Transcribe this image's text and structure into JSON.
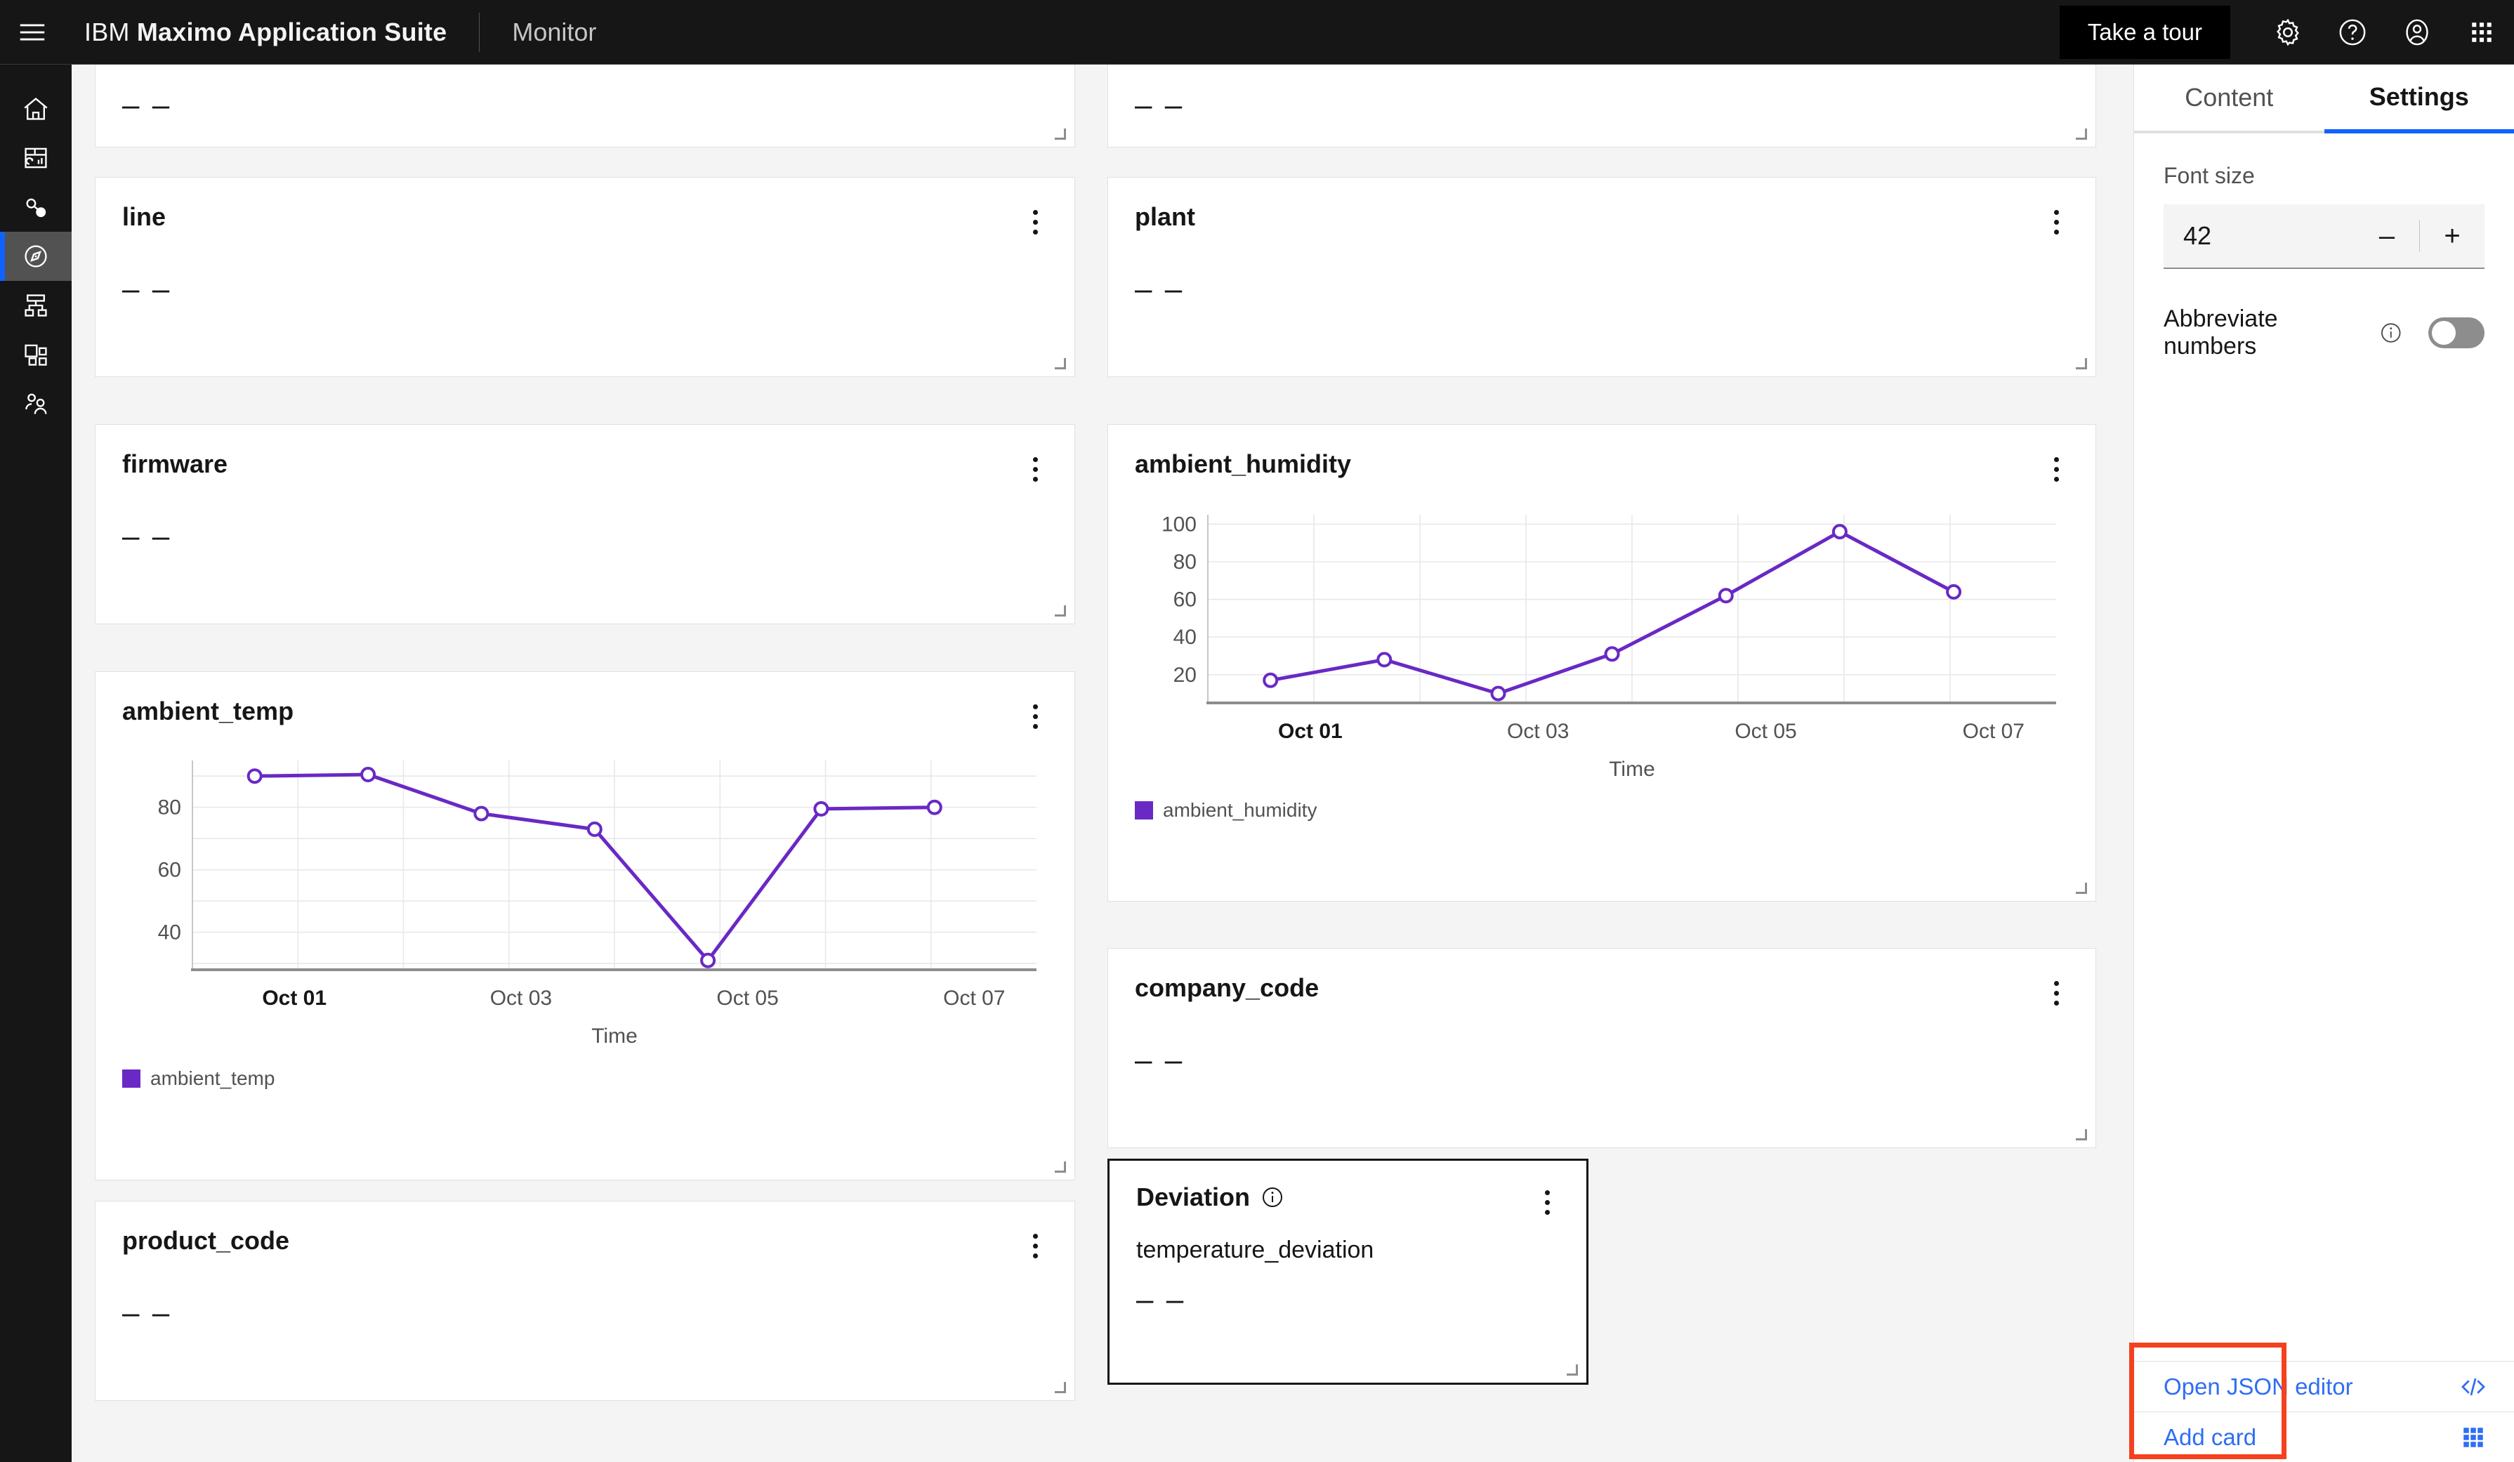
{
  "header": {
    "menu_icon": "hamburger-menu-icon",
    "brand_prefix": "IBM",
    "brand_name": "Maximo Application Suite",
    "product": "Monitor",
    "tour_label": "Take a tour",
    "icons": [
      "gear-icon",
      "help-icon",
      "user-avatar-icon",
      "app-switcher-icon"
    ]
  },
  "sidebar": {
    "items": [
      {
        "name": "home-icon",
        "label": "Home"
      },
      {
        "name": "dashboard-icon",
        "label": "Dashboard"
      },
      {
        "name": "asset-link-icon",
        "label": "Assets"
      },
      {
        "name": "compass-icon",
        "label": "Monitor",
        "active": true
      },
      {
        "name": "hierarchy-icon",
        "label": "Hierarchy"
      },
      {
        "name": "app-group-icon",
        "label": "Applications"
      },
      {
        "name": "users-icon",
        "label": "Users"
      }
    ]
  },
  "dashboard": {
    "placeholder_value": "– –",
    "cards": [
      {
        "id": "card-top-left",
        "title": "",
        "value": "– –"
      },
      {
        "id": "card-top-right",
        "title": "",
        "value": "– –"
      },
      {
        "id": "card-line",
        "title": "line",
        "value": "– –"
      },
      {
        "id": "card-plant",
        "title": "plant",
        "value": "– –"
      },
      {
        "id": "card-firmware",
        "title": "firmware",
        "value": "– –"
      },
      {
        "id": "card-company",
        "title": "company_code",
        "value": "– –"
      },
      {
        "id": "card-product",
        "title": "product_code",
        "value": "– –"
      },
      {
        "id": "card-deviation",
        "title": "Deviation",
        "subtitle": "temperature_deviation",
        "value": "– –",
        "selected": true,
        "has_info_icon": true
      }
    ]
  },
  "chart_data": [
    {
      "id": "ambient_temp",
      "type": "line",
      "title": "ambient_temp",
      "xlabel": "Time",
      "ylabel": "",
      "legend": [
        "ambient_temp"
      ],
      "legend_position": "bottom-left",
      "color": "#6929c4",
      "grid": true,
      "ylim": [
        28,
        95
      ],
      "yticks": [
        40,
        60,
        80
      ],
      "xticks": [
        "Oct 01",
        "Oct 03",
        "Oct 05",
        "Oct 07"
      ],
      "x": [
        "Oct 01",
        "Oct 01.5",
        "Oct 02.7",
        "Oct 03.5",
        "Oct 04.6",
        "Oct 05.5",
        "Oct 06.6"
      ],
      "values": [
        90,
        90.5,
        78,
        73,
        31,
        79.5,
        80
      ]
    },
    {
      "id": "ambient_humidity",
      "type": "line",
      "title": "ambient_humidity",
      "xlabel": "Time",
      "ylabel": "",
      "legend": [
        "ambient_humidity"
      ],
      "legend_position": "bottom-left",
      "color": "#6929c4",
      "grid": true,
      "ylim": [
        5,
        105
      ],
      "yticks": [
        20,
        40,
        60,
        80,
        100
      ],
      "xticks": [
        "Oct 01",
        "Oct 03",
        "Oct 05",
        "Oct 07"
      ],
      "x": [
        "Oct 01",
        "Oct 01.5",
        "Oct 02.7",
        "Oct 03.5",
        "Oct 04.6",
        "Oct 05.5",
        "Oct 06.6"
      ],
      "values": [
        17,
        28,
        10,
        31,
        62,
        96,
        64
      ]
    }
  ],
  "panel": {
    "tabs": [
      {
        "label": "Content",
        "active": false
      },
      {
        "label": "Settings",
        "active": true
      }
    ],
    "font_size_label": "Font size",
    "font_size_value": "42",
    "decrement_label": "–",
    "increment_label": "+",
    "abbreviate_label": "Abbreviate numbers",
    "abbreviate_on": false,
    "actions": [
      {
        "label": "Open JSON editor",
        "icon": "code-brackets-icon"
      },
      {
        "label": "Add card",
        "icon": "grid-dots-icon"
      }
    ]
  },
  "colors": {
    "accent_blue": "#0f62fe",
    "link_blue": "#2f6ef4",
    "chart_purple": "#6929c4",
    "annotation_red": "#f4411e",
    "header_bg": "#161616",
    "canvas_bg": "#f4f4f4"
  }
}
